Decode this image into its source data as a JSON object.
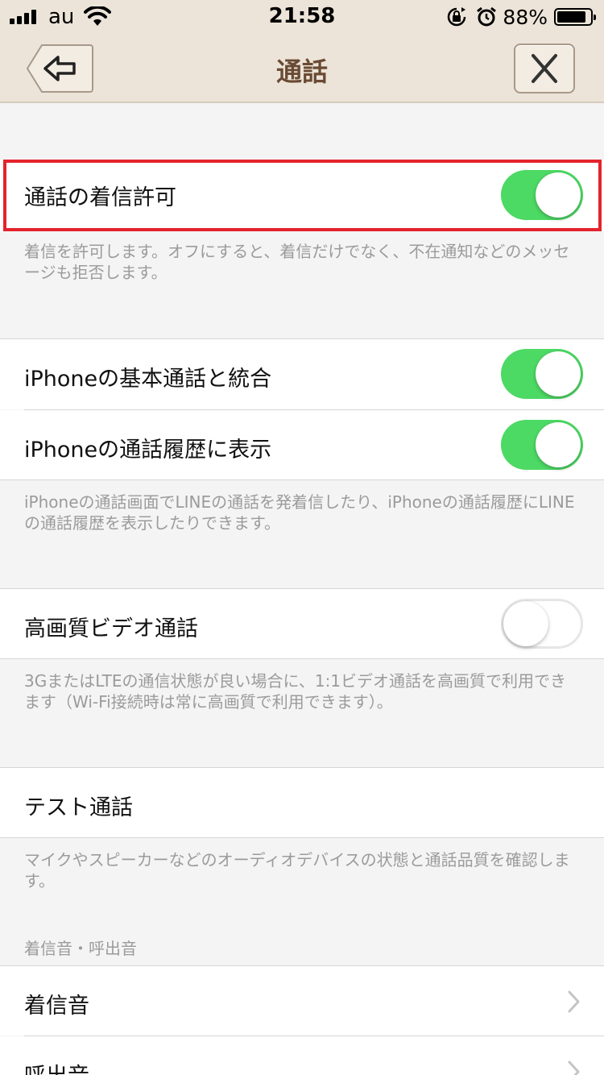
{
  "status_bar": {
    "carrier": "au",
    "time": "21:58",
    "battery_percent": "88%",
    "battery_level": 0.88,
    "icons": [
      "signal-icon",
      "wifi-icon",
      "orientation-lock-icon",
      "alarm-icon",
      "battery-icon"
    ]
  },
  "nav": {
    "title": "通話",
    "back_icon": "back-arrow-icon",
    "close_icon": "close-icon"
  },
  "sections": {
    "incoming": {
      "label": "通話の着信許可",
      "toggle_on": true,
      "footer": "着信を許可します。オフにすると、着信だけでなく、不在通知などのメッセージも拒否します。"
    },
    "integration": {
      "row1_label": "iPhoneの基本通話と統合",
      "row1_on": true,
      "row2_label": "iPhoneの通話履歴に表示",
      "row2_on": true,
      "footer": "iPhoneの通話画面でLINEの通話を発着信したり、iPhoneの通話履歴にLINEの通話履歴を表示したりできます。"
    },
    "hd_video": {
      "label": "高画質ビデオ通話",
      "toggle_on": false,
      "footer": "3GまたはLTEの通信状態が良い場合に、1:1ビデオ通話を高画質で利用できます（Wi-Fi接続時は常に高画質で利用できます）。"
    },
    "test_call": {
      "label": "テスト通話",
      "footer": "マイクやスピーカーなどのオーディオデバイスの状態と通話品質を確認します。"
    },
    "ringtones": {
      "header": "着信音・呼出音",
      "row1_label": "着信音",
      "row2_label": "呼出音"
    }
  },
  "colors": {
    "header_bg": "#ece4d8",
    "title": "#6a4a34",
    "toggle_on": "#4cd964",
    "highlight": "#e3232c",
    "footer_text": "#9b9b9b"
  }
}
